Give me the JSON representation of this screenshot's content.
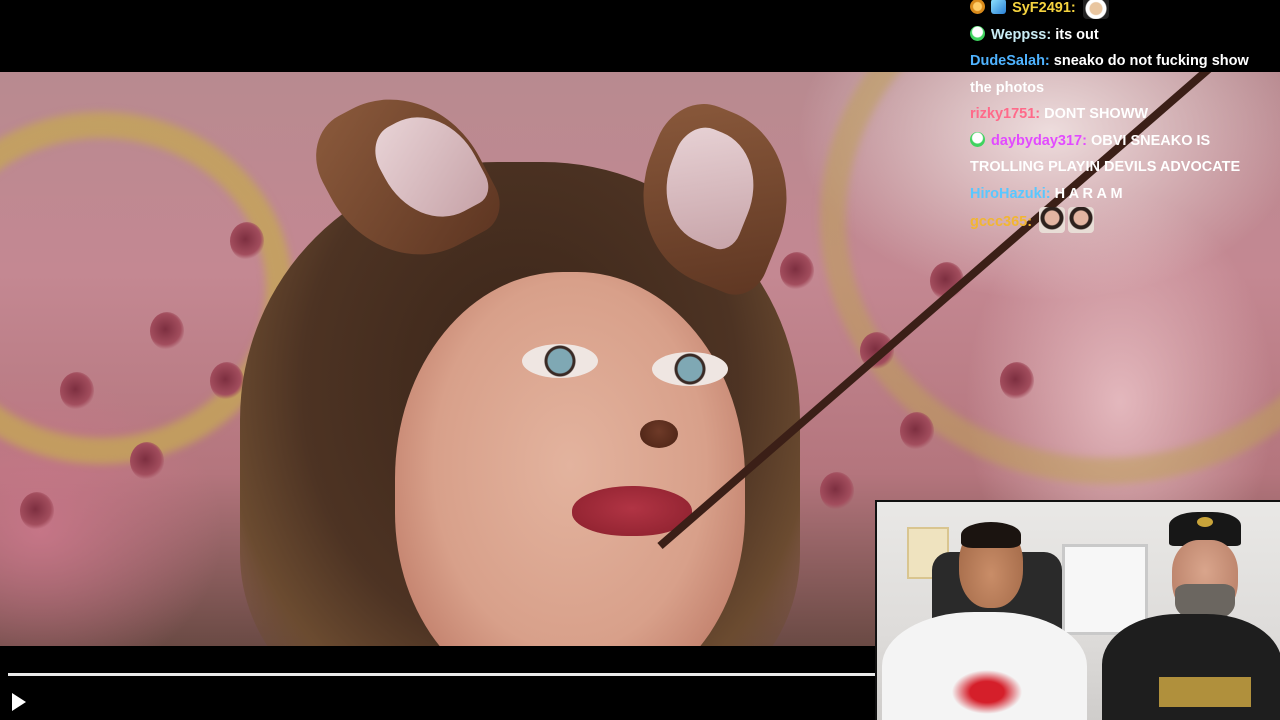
{
  "player": {
    "progress_fraction": 0.0,
    "play_icon": "play-icon"
  },
  "chat": {
    "messages": [
      {
        "user": "SyF2491:",
        "user_color": "#f5d33f",
        "text": "",
        "badges": [
          "coin-badge",
          "gem-badge"
        ],
        "emotes": [
          "chef-emote"
        ]
      },
      {
        "user": "Weppss:",
        "user_color": "#c9ecf5",
        "text": "its out",
        "badges": [
          "skull-badge"
        ],
        "emotes": []
      },
      {
        "user": "DudeSalah:",
        "user_color": "#4fb3ff",
        "text": "sneako do not fucking show the photos",
        "badges": [],
        "emotes": []
      },
      {
        "user": "rizky1751:",
        "user_color": "#ff6a8a",
        "text": "DONT SHOWW",
        "badges": [],
        "emotes": []
      },
      {
        "user": "daybyday317:",
        "user_color": "#e24bff",
        "text": "OBVI SNEAKO IS TROLLING PLAYIN DEVILS ADVOCATE",
        "badges": [
          "skull-badge"
        ],
        "emotes": []
      },
      {
        "user": "HiroHazuki:",
        "user_color": "#59c7ff",
        "text": "H A R A M",
        "badges": [],
        "emotes": []
      },
      {
        "user": "gccc365:",
        "user_color": "#f2b632",
        "text": "",
        "badges": [],
        "emotes": [
          "face-emote",
          "face-emote"
        ]
      }
    ]
  },
  "colors": {
    "background": "#000000",
    "progress_track": "#e9e9e9"
  }
}
